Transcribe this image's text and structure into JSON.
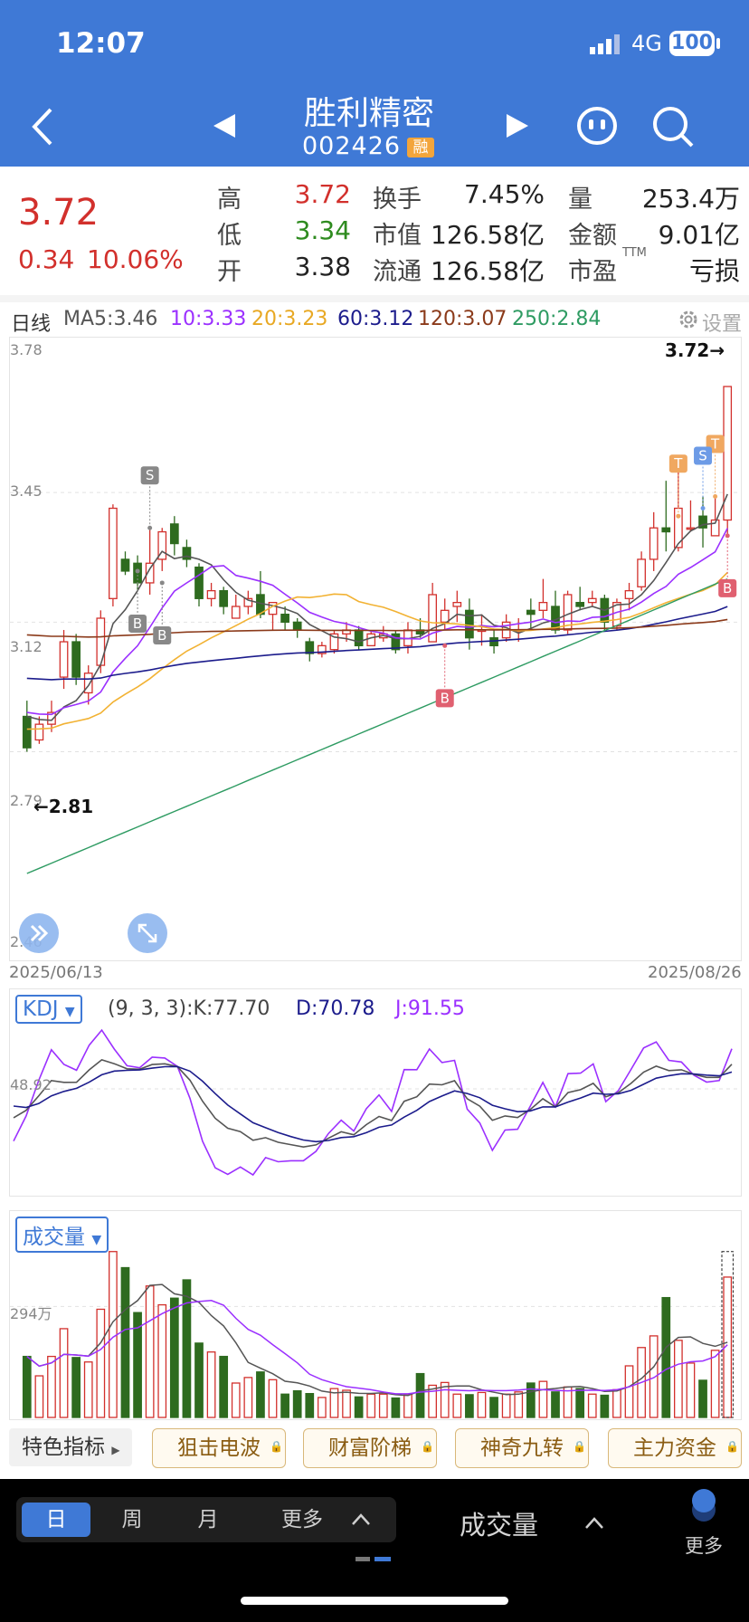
{
  "status": {
    "time": "12:07",
    "network": "4G",
    "battery": "100"
  },
  "header": {
    "name": "胜利精密",
    "code": "002426",
    "badge": "融"
  },
  "quote": {
    "price": "3.72",
    "change": "0.34",
    "change_pct": "10.06%",
    "high_label": "高",
    "high": "3.72",
    "low_label": "低",
    "low": "3.34",
    "open_label": "开",
    "open": "3.38",
    "turnover_label": "换手",
    "turnover": "7.45%",
    "mcap_label": "市值",
    "mcap": "126.58亿",
    "float_label": "流通",
    "float": "126.58亿",
    "vol_label": "量",
    "vol": "253.4万",
    "amount_label": "金额",
    "amount": "9.01亿",
    "pe_label": "市盈",
    "pe_sup": "TTM",
    "pe": "亏损"
  },
  "ma_bar": {
    "period": "日线",
    "ma5": "MA5:3.46",
    "ma10": "10:3.33",
    "ma20": "20:3.23",
    "ma60": "60:3.12",
    "ma120": "120:3.07",
    "ma250": "250:2.84",
    "settings": "设置"
  },
  "colors": {
    "header_bg": "#3f79d6",
    "up": "#d2302c",
    "down": "#2e6b1f",
    "flat_text": "#222222",
    "ma5": "#555555",
    "ma10": "#9b30ff",
    "ma20": "#f2b233",
    "ma60": "#1c1c8c",
    "ma120": "#8b3a1a",
    "ma250": "#2e9b62"
  },
  "chart_data": [
    {
      "type": "candlestick",
      "start_date": "2025/06/13",
      "end_date": "2025/08/26",
      "ylim": [
        2.48,
        3.78
      ],
      "y_ticks": [
        "3.78",
        "3.45",
        "3.12",
        "2.79",
        "2.46"
      ],
      "high_annotation": "3.72→",
      "low_annotation": "←2.81",
      "candles": [
        [
          2.88,
          2.8,
          2.92,
          2.79
        ],
        [
          2.82,
          2.86,
          2.88,
          2.81
        ],
        [
          2.86,
          2.89,
          2.92,
          2.84
        ],
        [
          2.98,
          3.07,
          3.1,
          2.95
        ],
        [
          3.07,
          2.98,
          3.09,
          2.96
        ],
        [
          2.94,
          2.99,
          3.01,
          2.91
        ],
        [
          3.01,
          3.13,
          3.15,
          2.99
        ],
        [
          3.18,
          3.41,
          3.42,
          3.16
        ],
        [
          3.28,
          3.25,
          3.3,
          3.24
        ],
        [
          3.27,
          3.22,
          3.29,
          3.2
        ],
        [
          3.22,
          3.27,
          3.36,
          3.19
        ],
        [
          3.28,
          3.35,
          3.36,
          3.25
        ],
        [
          3.37,
          3.32,
          3.39,
          3.29
        ],
        [
          3.31,
          3.28,
          3.33,
          3.26
        ],
        [
          3.26,
          3.18,
          3.27,
          3.16
        ],
        [
          3.18,
          3.2,
          3.22,
          3.16
        ],
        [
          3.2,
          3.16,
          3.21,
          3.14
        ],
        [
          3.13,
          3.16,
          3.19,
          3.13
        ],
        [
          3.16,
          3.18,
          3.2,
          3.14
        ],
        [
          3.19,
          3.14,
          3.25,
          3.13
        ],
        [
          3.14,
          3.17,
          3.17,
          3.1
        ],
        [
          3.14,
          3.12,
          3.16,
          3.1
        ],
        [
          3.12,
          3.1,
          3.13,
          3.08
        ],
        [
          3.07,
          3.04,
          3.08,
          3.02
        ],
        [
          3.04,
          3.06,
          3.07,
          3.03
        ],
        [
          3.05,
          3.09,
          3.1,
          3.04
        ],
        [
          3.09,
          3.1,
          3.12,
          3.07
        ],
        [
          3.1,
          3.06,
          3.11,
          3.05
        ],
        [
          3.06,
          3.09,
          3.1,
          3.06
        ],
        [
          3.08,
          3.09,
          3.11,
          3.07
        ],
        [
          3.09,
          3.05,
          3.1,
          3.04
        ],
        [
          3.06,
          3.1,
          3.12,
          3.04
        ],
        [
          3.1,
          3.09,
          3.13,
          3.08
        ],
        [
          3.07,
          3.19,
          3.22,
          3.07
        ],
        [
          3.12,
          3.15,
          3.18,
          3.1
        ],
        [
          3.16,
          3.17,
          3.2,
          3.12
        ],
        [
          3.15,
          3.08,
          3.18,
          3.05
        ],
        [
          3.1,
          3.1,
          3.14,
          3.06
        ],
        [
          3.08,
          3.06,
          3.1,
          3.04
        ],
        [
          3.08,
          3.12,
          3.14,
          3.07
        ],
        [
          3.1,
          3.1,
          3.13,
          3.07
        ],
        [
          3.15,
          3.14,
          3.18,
          3.1
        ],
        [
          3.15,
          3.17,
          3.23,
          3.13
        ],
        [
          3.16,
          3.1,
          3.2,
          3.09
        ],
        [
          3.1,
          3.19,
          3.2,
          3.09
        ],
        [
          3.17,
          3.16,
          3.21,
          3.15
        ],
        [
          3.17,
          3.18,
          3.2,
          3.16
        ],
        [
          3.18,
          3.12,
          3.19,
          3.1
        ],
        [
          3.11,
          3.17,
          3.18,
          3.1
        ],
        [
          3.18,
          3.2,
          3.22,
          3.15
        ],
        [
          3.21,
          3.28,
          3.3,
          3.2
        ],
        [
          3.28,
          3.36,
          3.4,
          3.25
        ],
        [
          3.36,
          3.35,
          3.48,
          3.3
        ],
        [
          3.31,
          3.41,
          3.51,
          3.3
        ],
        [
          3.36,
          3.36,
          3.43,
          3.35
        ],
        [
          3.39,
          3.36,
          3.44,
          3.31
        ],
        [
          3.34,
          3.38,
          3.44,
          3.34
        ],
        [
          3.38,
          3.72,
          3.72,
          3.34
        ]
      ]
    },
    {
      "type": "line",
      "name": "KDJ",
      "params": "(9, 3, 3):K:77.70",
      "d_label": "D:70.78",
      "j_label": "J:91.55",
      "y_tick": "48.92"
    },
    {
      "type": "bar",
      "name": "成交量",
      "y_tick": "294万",
      "values": [
        110,
        75,
        110,
        160,
        108,
        100,
        195,
        299,
        270,
        189,
        237,
        203,
        215,
        248,
        134,
        118,
        110,
        62,
        72,
        82,
        68,
        42,
        48,
        43,
        36,
        52,
        49,
        37,
        42,
        42,
        35,
        42,
        79,
        58,
        63,
        42,
        41,
        45,
        36,
        42,
        46,
        62,
        65,
        46,
        55,
        52,
        42,
        40,
        50,
        93,
        126,
        147,
        216,
        139,
        98,
        67,
        121,
        253
      ]
    }
  ],
  "indicators": {
    "special": "特色指标",
    "items": [
      "狙击电波",
      "财富阶梯",
      "神奇九转",
      "主力资金"
    ]
  },
  "bottom": {
    "periods": [
      "日",
      "周",
      "月",
      "更多"
    ],
    "vol_select": "成交量",
    "more": "更多"
  }
}
